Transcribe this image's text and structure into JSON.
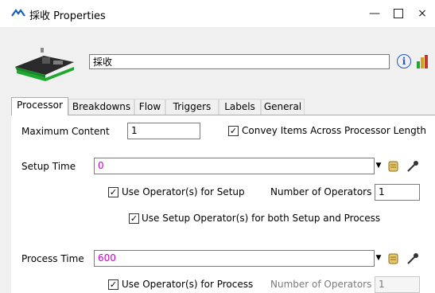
{
  "window": {
    "title": "採收 Properties",
    "minimize_glyph": "—",
    "close_glyph": "×"
  },
  "object": {
    "name": "採收",
    "info_glyph": "i"
  },
  "tabs": [
    {
      "label": "Processor",
      "active": true
    },
    {
      "label": "Breakdowns"
    },
    {
      "label": "Flow"
    },
    {
      "label": "Triggers"
    },
    {
      "label": "Labels"
    },
    {
      "label": "General"
    }
  ],
  "processor": {
    "max_content_label": "Maximum Content",
    "max_content_value": "1",
    "convey_label": "Convey Items Across Processor Length",
    "convey_checked": true,
    "setup_time_label": "Setup Time",
    "setup_time_value": "0",
    "use_operators_setup_label": "Use Operator(s) for Setup",
    "use_operators_setup_checked": true,
    "num_operators_label": "Number of Operators",
    "num_operators_setup_value": "1",
    "use_setup_both_label": "Use Setup Operator(s) for both Setup and Process",
    "use_setup_both_checked": true,
    "process_time_label": "Process Time",
    "process_time_value": "600",
    "use_operators_process_label": "Use Operator(s) for Process",
    "use_operators_process_checked": true,
    "num_operators_process_label": "Number of Operators",
    "num_operators_process_value": "1"
  },
  "glyphs": {
    "check": "✓",
    "dropdown": "▼"
  }
}
